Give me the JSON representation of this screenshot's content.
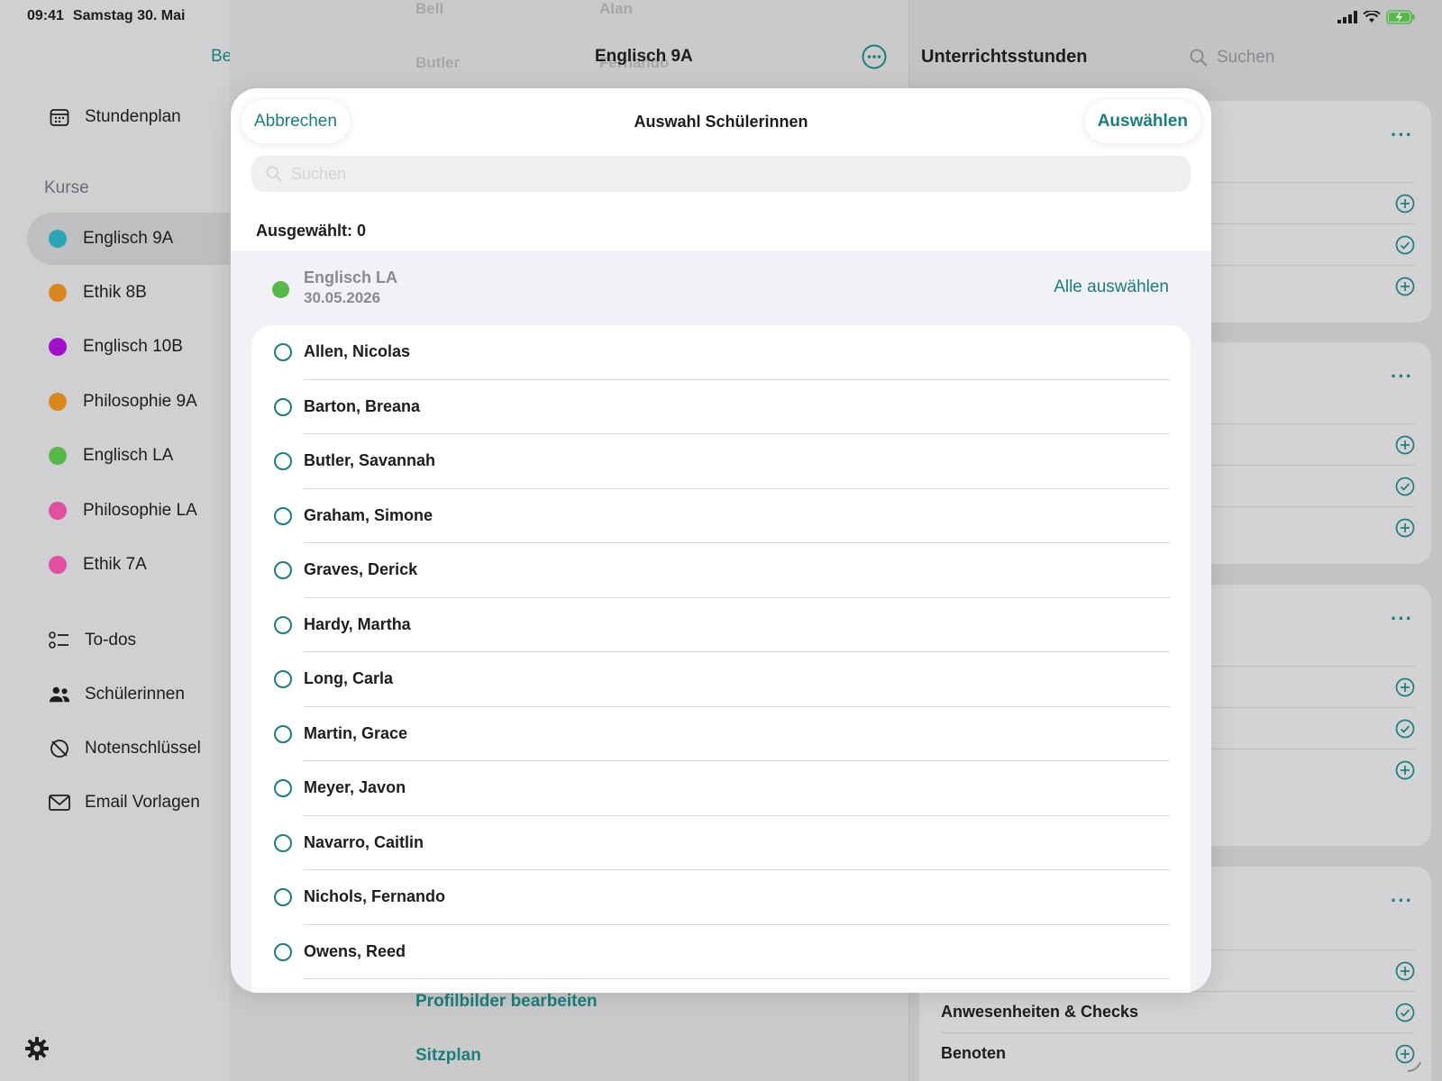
{
  "status_bar": {
    "time": "09:41",
    "date": "Samstag 30. Mai"
  },
  "sidebar": {
    "edit_label": "Bearbeiten",
    "schedule_label": "Stundenplan",
    "section_label": "Kurse",
    "courses": [
      {
        "label": "Englisch 9A",
        "color": "#2aa6b8",
        "selected": true
      },
      {
        "label": "Ethik 8B",
        "color": "#d9891c"
      },
      {
        "label": "Englisch 10B",
        "color": "#a10fc9"
      },
      {
        "label": "Philosophie 9A",
        "color": "#d9891c"
      },
      {
        "label": "Englisch LA",
        "color": "#56b948"
      },
      {
        "label": "Philosophie LA",
        "color": "#e04fa0"
      },
      {
        "label": "Ethik 7A",
        "color": "#e04fa0"
      }
    ],
    "tools": [
      {
        "label": "To-dos",
        "icon": "checklist-icon"
      },
      {
        "label": "Schülerinnen",
        "icon": "people-icon"
      },
      {
        "label": "Notenschlüssel",
        "icon": "grade-key-icon"
      },
      {
        "label": "Email Vorlagen",
        "icon": "envelope-icon"
      }
    ]
  },
  "detail": {
    "title": "Englisch 9A",
    "ghost_rows": [
      {
        "last": "Bell",
        "first": "Alan"
      },
      {
        "last": "Butler",
        "first": "Fernando"
      }
    ],
    "links": [
      "Profilbilder bearbeiten",
      "Sitzplan"
    ]
  },
  "lessons": {
    "title": "Unterrichtsstunden",
    "search_placeholder": "Suchen",
    "last_card_rows": [
      "Anwesenheiten & Checks",
      "Benoten"
    ]
  },
  "sheet": {
    "title": "Auswahl Schülerinnen",
    "cancel_label": "Abbrechen",
    "confirm_label": "Auswählen",
    "search_placeholder": "Suchen",
    "selected_count": "Ausgewählt: 0",
    "group": {
      "name": "Englisch LA",
      "date": "30.05.2026",
      "color": "#56b948",
      "select_all_label": "Alle auswählen"
    },
    "students": [
      "Allen, Nicolas",
      "Barton, Breana",
      "Butler, Savannah",
      "Graham, Simone",
      "Graves, Derick",
      "Hardy, Martha",
      "Long, Carla",
      "Martin, Grace",
      "Meyer, Javon",
      "Navarro, Caitlin",
      "Nichols, Fernando",
      "Owens, Reed"
    ]
  },
  "colors": {
    "accent": "#1a7f7b"
  }
}
